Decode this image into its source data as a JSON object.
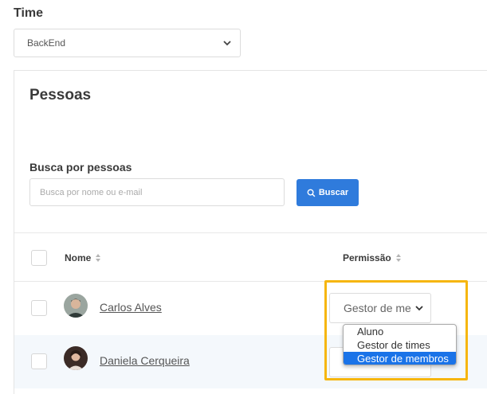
{
  "team": {
    "label": "Time",
    "selected": "BackEnd"
  },
  "card": {
    "title": "Pessoas",
    "search_label": "Busca por pessoas",
    "search_placeholder": "Busca por nome ou e-mail",
    "search_button": "Buscar"
  },
  "table": {
    "columns": [
      {
        "label": "Nome",
        "sortable": true
      },
      {
        "label": "Permissão",
        "sortable": true
      }
    ],
    "rows": [
      {
        "name": "Carlos Alves",
        "permission": "Gestor de membros",
        "permission_display": "Gestor de me"
      },
      {
        "name": "Daniela Cerqueira",
        "permission": ""
      }
    ]
  },
  "permission_dropdown": {
    "options": [
      "Aluno",
      "Gestor de times",
      "Gestor de membros"
    ],
    "selected": "Gestor de membros"
  },
  "colors": {
    "accent": "#2f7bdc",
    "highlight": "#f6b60e",
    "option_selected": "#1a73e8"
  }
}
